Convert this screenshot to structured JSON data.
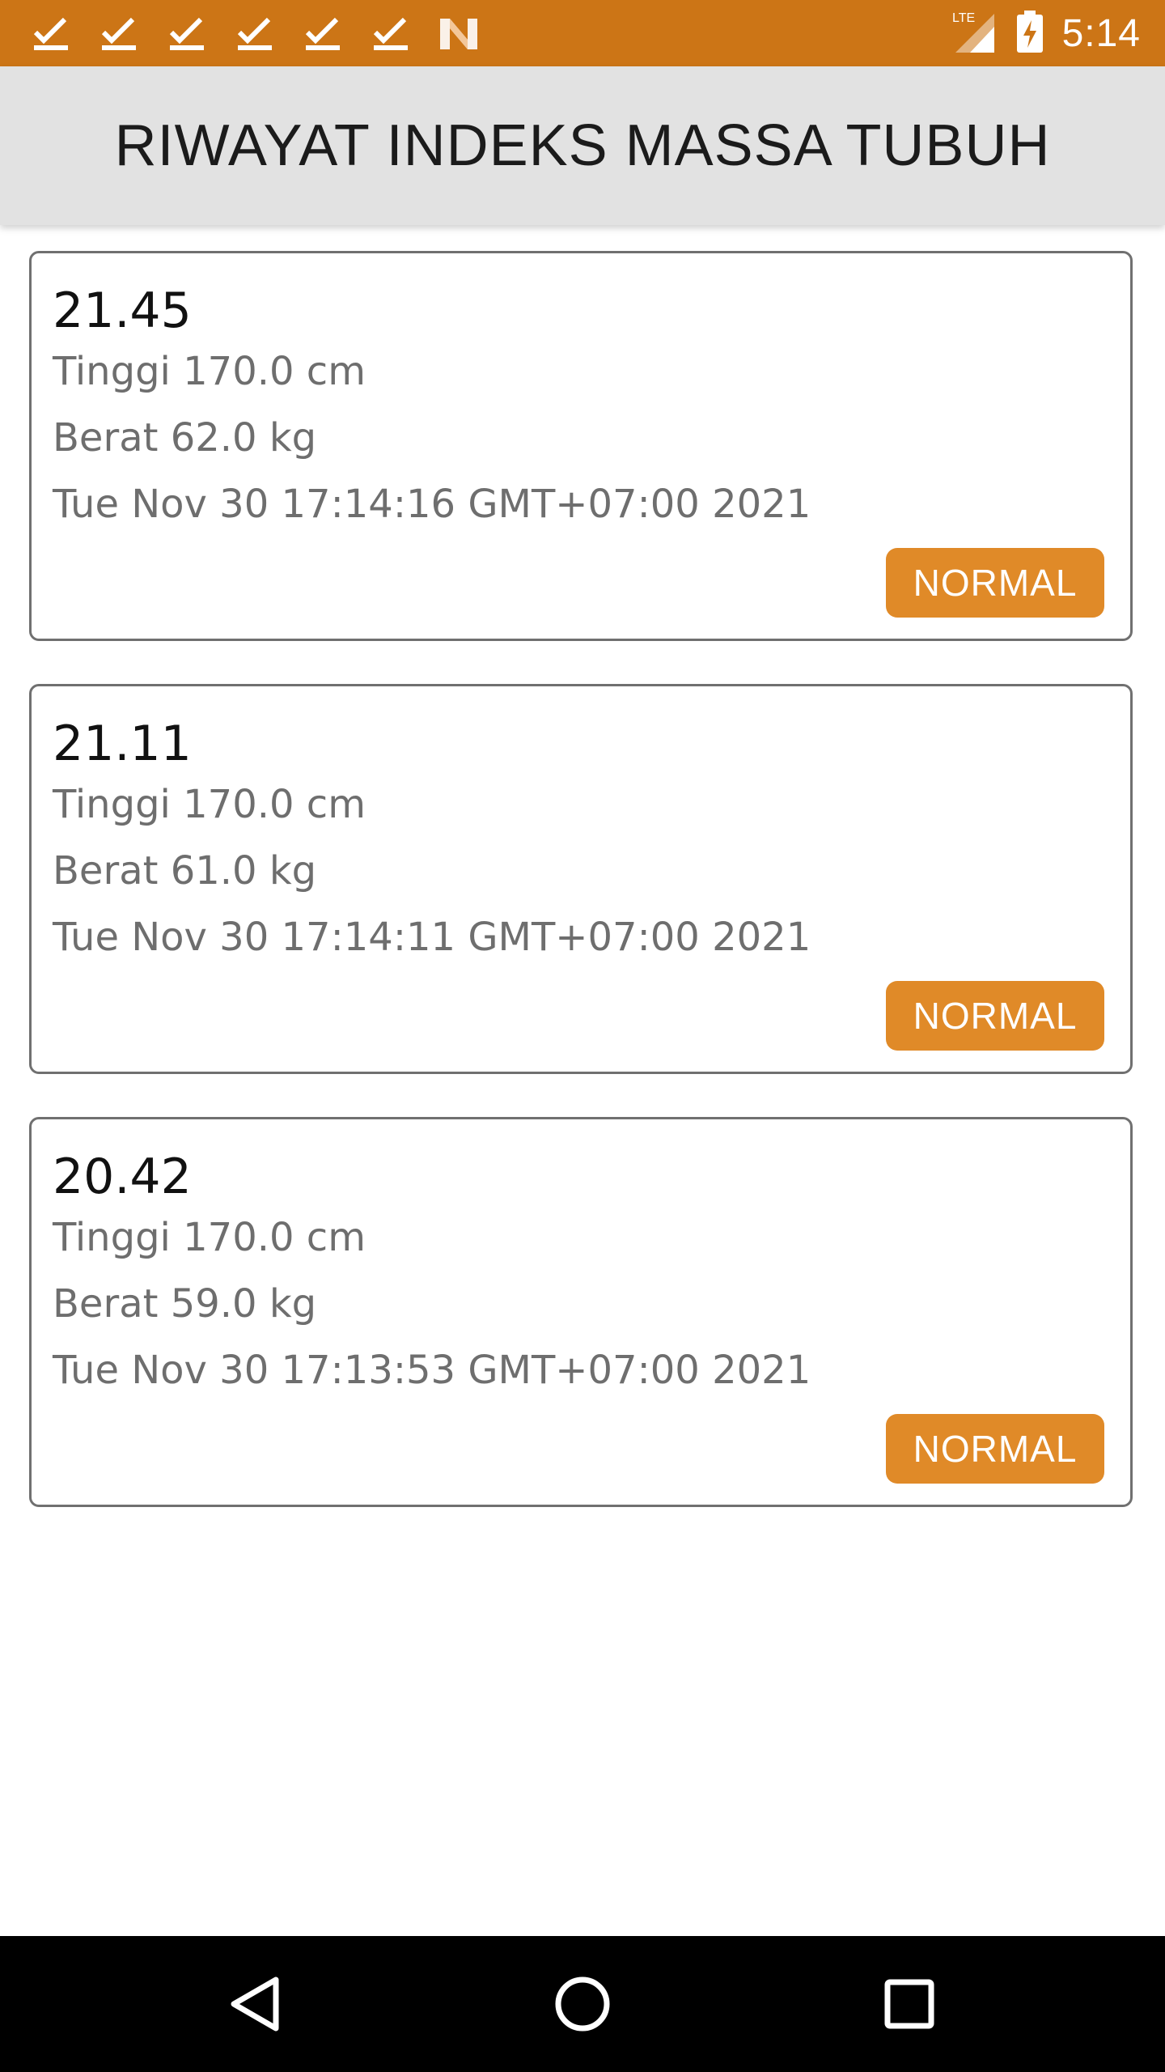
{
  "status_bar": {
    "time": "5:14",
    "notification_icons": [
      "checkmark-icon",
      "checkmark-icon",
      "checkmark-icon",
      "checkmark-icon",
      "checkmark-icon",
      "checkmark-icon",
      "app-n-icon"
    ],
    "network_label": "LTE",
    "background_color": "#cc7516"
  },
  "app_bar": {
    "title": "RIWAYAT INDEKS MASSA TUBUH",
    "background_color": "#e2e2e2"
  },
  "history": [
    {
      "bmi": "21.45",
      "height": "Tinggi 170.0 cm",
      "weight": "Berat 62.0 kg",
      "date": "Tue Nov 30 17:14:16 GMT+07:00 2021",
      "status": "NORMAL"
    },
    {
      "bmi": "21.11",
      "height": "Tinggi 170.0 cm",
      "weight": "Berat 61.0 kg",
      "date": "Tue Nov 30 17:14:11 GMT+07:00 2021",
      "status": "NORMAL"
    },
    {
      "bmi": "20.42",
      "height": "Tinggi 170.0 cm",
      "weight": "Berat 59.0 kg",
      "date": "Tue Nov 30 17:13:53 GMT+07:00 2021",
      "status": "NORMAL"
    }
  ],
  "badge_color": "#e08a28",
  "nav_bar": {
    "buttons": [
      "back-icon",
      "home-icon",
      "recents-icon"
    ]
  }
}
